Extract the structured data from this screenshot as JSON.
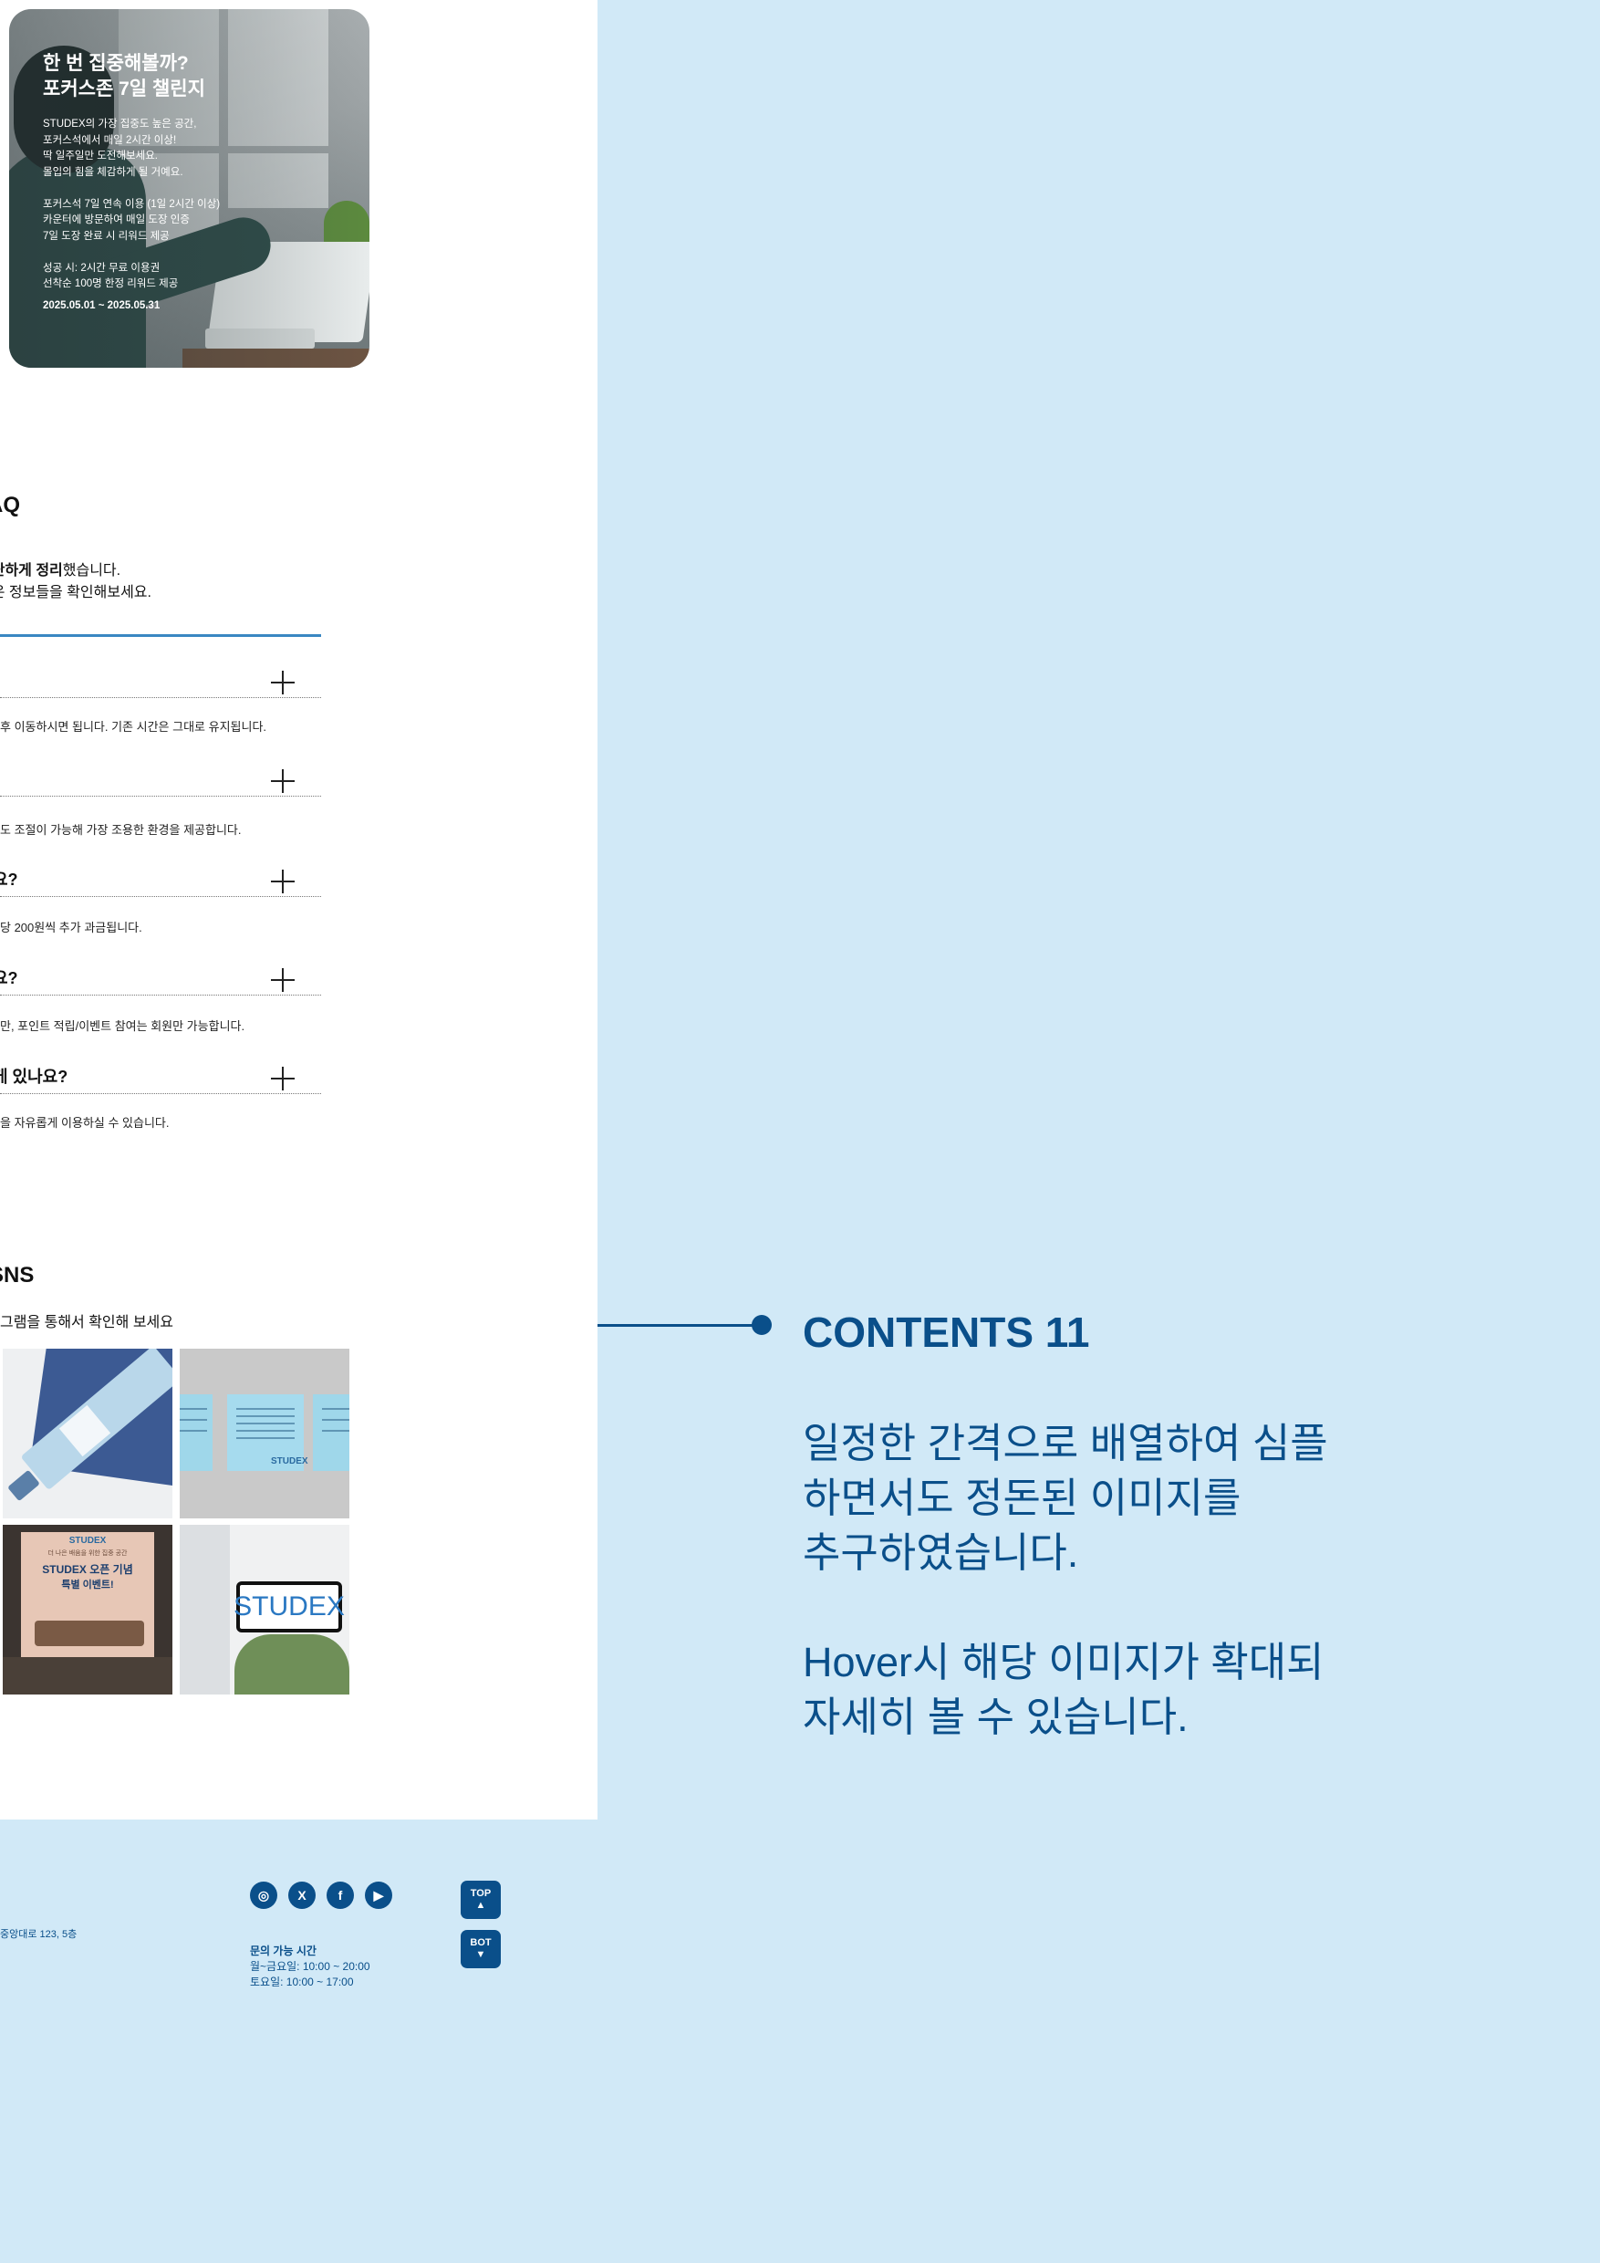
{
  "challenge": {
    "title": "한 번 집중해볼까?\n포커스존 7일 챌린지",
    "body": "STUDEX의 가장 집중도 높은 공간,\n포커스석에서 매일 2시간 이상!\n딱 일주일만 도전해보세요.\n몰입의 힘을 체감하게 될 거예요.\n\n포커스석 7일 연속 이용 (1일 2시간 이상)\n카운터에 방문하여 매일 도장 인증\n7일 도장 완료 시 리워드 제공\n\n성공 시: 2시간 무료 이용권\n선착순 100명 한정 리워드 제공",
    "date": "2025.05.01 ~ 2025.05.31"
  },
  "faq": {
    "title": "AQ",
    "intro_bold": "간단하게 정리",
    "intro_rest": "했습니다.",
    "intro_line2": "좋은 정보들을 확인해보세요.",
    "items": [
      {
        "q": "",
        "a": "후 이동하시면 됩니다. 기존 시간은 그대로 유지됩니다."
      },
      {
        "q": "",
        "a": "도 조절이 가능해 가장 조용한 환경을 제공합니다."
      },
      {
        "q": "요?",
        "a": "당 200원씩 추가 과금됩니다."
      },
      {
        "q": "요?",
        "a": "만, 포인트 적립/이벤트 참여는 회원만 가능합니다."
      },
      {
        "q": " 게 있나요?",
        "a": "을 자유롭게 이용하실 수 있습니다."
      }
    ]
  },
  "sns": {
    "title": "SNS",
    "desc": "그램을 통해서 확인해 보세요",
    "tile3_line1": "STUDEX",
    "tile3_line2": "더 나은 배움을 위한 집중 공간",
    "tile3_line3": "STUDEX 오픈 기념",
    "tile3_line4": "특별 이벤트!",
    "tile4_sign": "STUDEX",
    "tile2_brand": "STUDEX"
  },
  "contents": {
    "title": "CONTENTS 11",
    "desc": "일정한 간격으로 배열하여 심플\n하면서도 정돈된 이미지를\n추구하였습니다.\n\nHover시 해당 이미지가 확대되\n자세히 볼 수 있습니다."
  },
  "footer": {
    "address": "중앙대로 123, 5층",
    "social": [
      {
        "icon": "instagram-icon",
        "glyph": "◎"
      },
      {
        "icon": "x-icon",
        "glyph": "X"
      },
      {
        "icon": "facebook-icon",
        "glyph": "f"
      },
      {
        "icon": "youtube-icon",
        "glyph": "▶"
      }
    ],
    "hours_title": "문의 가능 시간",
    "hours_weekday": "월~금요일: 10:00 ~ 20:00",
    "hours_sat": "토요일: 10:00 ~ 17:00",
    "top_label": "TOP",
    "top_arrow": "▲",
    "bot_label": "BOT",
    "bot_arrow": "▼"
  },
  "colors": {
    "background": "#d1e9f7",
    "accent": "#0a4f8a",
    "faq_line": "#3a87c2"
  }
}
